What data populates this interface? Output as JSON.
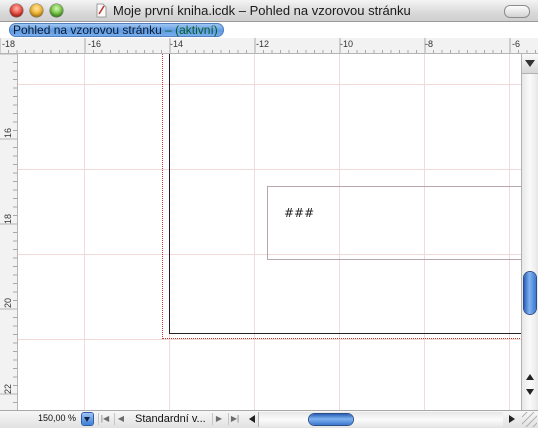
{
  "window": {
    "title": "Moje první kniha.icdk – Pohled na vzorovou stránku"
  },
  "view_tab": {
    "name": "Pohled na vzorovou stránku",
    "state": "– (aktivní)"
  },
  "rulers": {
    "horizontal_labels": [
      "-18",
      "-16",
      "-14",
      "-12",
      "-10",
      "-8",
      "-6"
    ],
    "vertical_labels": [
      "16",
      "18",
      "20",
      "22"
    ]
  },
  "canvas": {
    "frame_text": "###"
  },
  "bottom_bar": {
    "zoom_value": "150,00 %",
    "first_page_label": "|◀",
    "prev_page_label": "◀",
    "page_name": "Standardní v...",
    "next_page_label": "▶",
    "last_page_label": "▶|"
  },
  "colors": {
    "accent_blue": "#5e9ae3",
    "guide_red": "#c0392b",
    "grid_pink": "#f3dada"
  },
  "icons": [
    "close-icon",
    "minimize-icon",
    "zoom-icon",
    "document-icon",
    "toolbar-toggle-icon",
    "split-view-icon",
    "scroll-up-icon",
    "scroll-down-icon",
    "scroll-left-icon",
    "scroll-right-icon",
    "resize-grip-icon"
  ]
}
